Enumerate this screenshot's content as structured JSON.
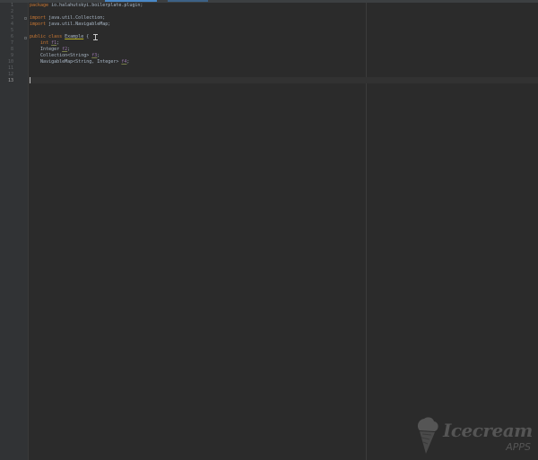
{
  "editor": {
    "line_numbers": [
      "1",
      "2",
      "3",
      "4",
      "5",
      "6",
      "7",
      "8",
      "9",
      "10",
      "11",
      "12",
      "13"
    ],
    "current_line": "13",
    "lines": {
      "l1": {
        "kw": "package",
        "rest": " io.halahutskyi.boilerplate.plugin;"
      },
      "l3": {
        "kw": "import",
        "rest": " java.util.Collection;"
      },
      "l4": {
        "kw": "import",
        "rest": " java.util.NavigableMap;"
      },
      "l6": {
        "kw1": "public",
        "kw2": " class",
        "space": " ",
        "class_name": "Example",
        "rest": " {"
      },
      "l7": {
        "indent": "    ",
        "kw": "int",
        "space": " ",
        "field": "f1",
        "end": ";"
      },
      "l8": {
        "indent": "    ",
        "type": "Integer",
        "space": " ",
        "field": "f2",
        "end": ";"
      },
      "l9": {
        "indent": "    ",
        "type": "Collection<String>",
        "space": " ",
        "field": "f3",
        "end": ";"
      },
      "l10": {
        "indent": "    ",
        "type": "NavigableMap<String, Integer>",
        "space": " ",
        "field": "f4",
        "end": ";"
      }
    }
  },
  "watermark": {
    "name": "Icecream",
    "sub": "APPS",
    "logo_icon": "ice-cream-cone-icon"
  },
  "colors": {
    "background": "#2b2b2b",
    "gutter": "#313335",
    "keyword": "#cc7832",
    "text": "#a9b7c6",
    "field": "#9876aa"
  }
}
